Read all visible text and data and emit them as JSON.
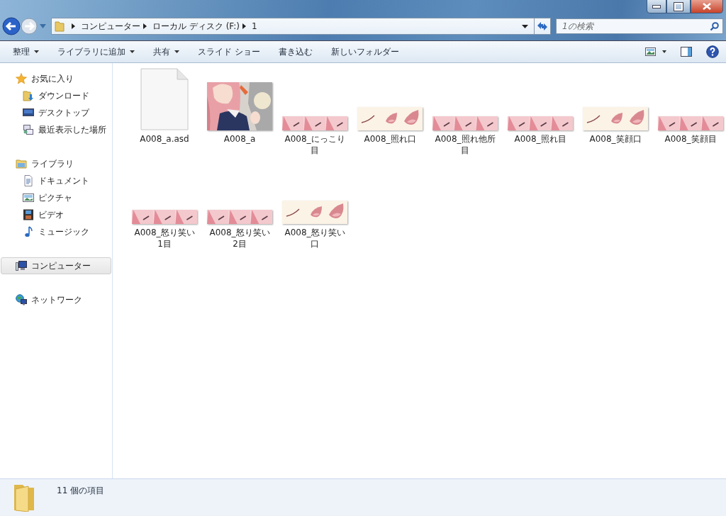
{
  "address_bar": {
    "segments": [
      "コンピューター",
      "ローカル ディスク (F:)",
      "1"
    ]
  },
  "search": {
    "placeholder": "1の検索"
  },
  "toolbar": [
    {
      "label": "整理",
      "dropdown": true
    },
    {
      "label": "ライブラリに追加",
      "dropdown": true
    },
    {
      "label": "共有",
      "dropdown": true
    },
    {
      "label": "スライド ショー",
      "dropdown": false
    },
    {
      "label": "書き込む",
      "dropdown": false
    },
    {
      "label": "新しいフォルダー",
      "dropdown": false
    }
  ],
  "sidebar": [
    {
      "label": "お気に入り",
      "kind": "star",
      "selected": false,
      "children": [
        {
          "label": "ダウンロード",
          "kind": "download",
          "selected": false
        },
        {
          "label": "デスクトップ",
          "kind": "desktop",
          "selected": false
        },
        {
          "label": "最近表示した場所",
          "kind": "recent",
          "selected": false
        }
      ]
    },
    {
      "label": "ライブラリ",
      "kind": "library",
      "selected": false,
      "children": [
        {
          "label": "ドキュメント",
          "kind": "document",
          "selected": false
        },
        {
          "label": "ピクチャ",
          "kind": "pictures",
          "selected": false
        },
        {
          "label": "ビデオ",
          "kind": "video",
          "selected": false
        },
        {
          "label": "ミュージック",
          "kind": "music",
          "selected": false
        }
      ]
    },
    {
      "label": "コンピューター",
      "kind": "computer",
      "selected": true
    },
    {
      "label": "ネットワーク",
      "kind": "network",
      "selected": false
    }
  ],
  "files": [
    {
      "name": "A008_a.asd",
      "kind": "document"
    },
    {
      "name": "A008_a"
    },
    {
      "name": "A008_にっこり目",
      "kind": "eye-strip"
    },
    {
      "name": "A008_照れ口",
      "kind": "mouth-strip"
    },
    {
      "name": "A008_照れ他所目",
      "kind": "eye-strip"
    },
    {
      "name": "A008_照れ目",
      "kind": "eye-strip"
    },
    {
      "name": "A008_笑顔口",
      "kind": "mouth-strip"
    },
    {
      "name": "A008_笑顔目",
      "kind": "eye-strip"
    },
    {
      "name": "A008_怒り笑い1目",
      "kind": "eye-strip"
    },
    {
      "name": "A008_怒り笑い2目",
      "kind": "eye-strip"
    },
    {
      "name": "A008_怒り笑い口",
      "kind": "mouth-strip"
    }
  ],
  "status_bar": {
    "count": "11 個の項目"
  }
}
